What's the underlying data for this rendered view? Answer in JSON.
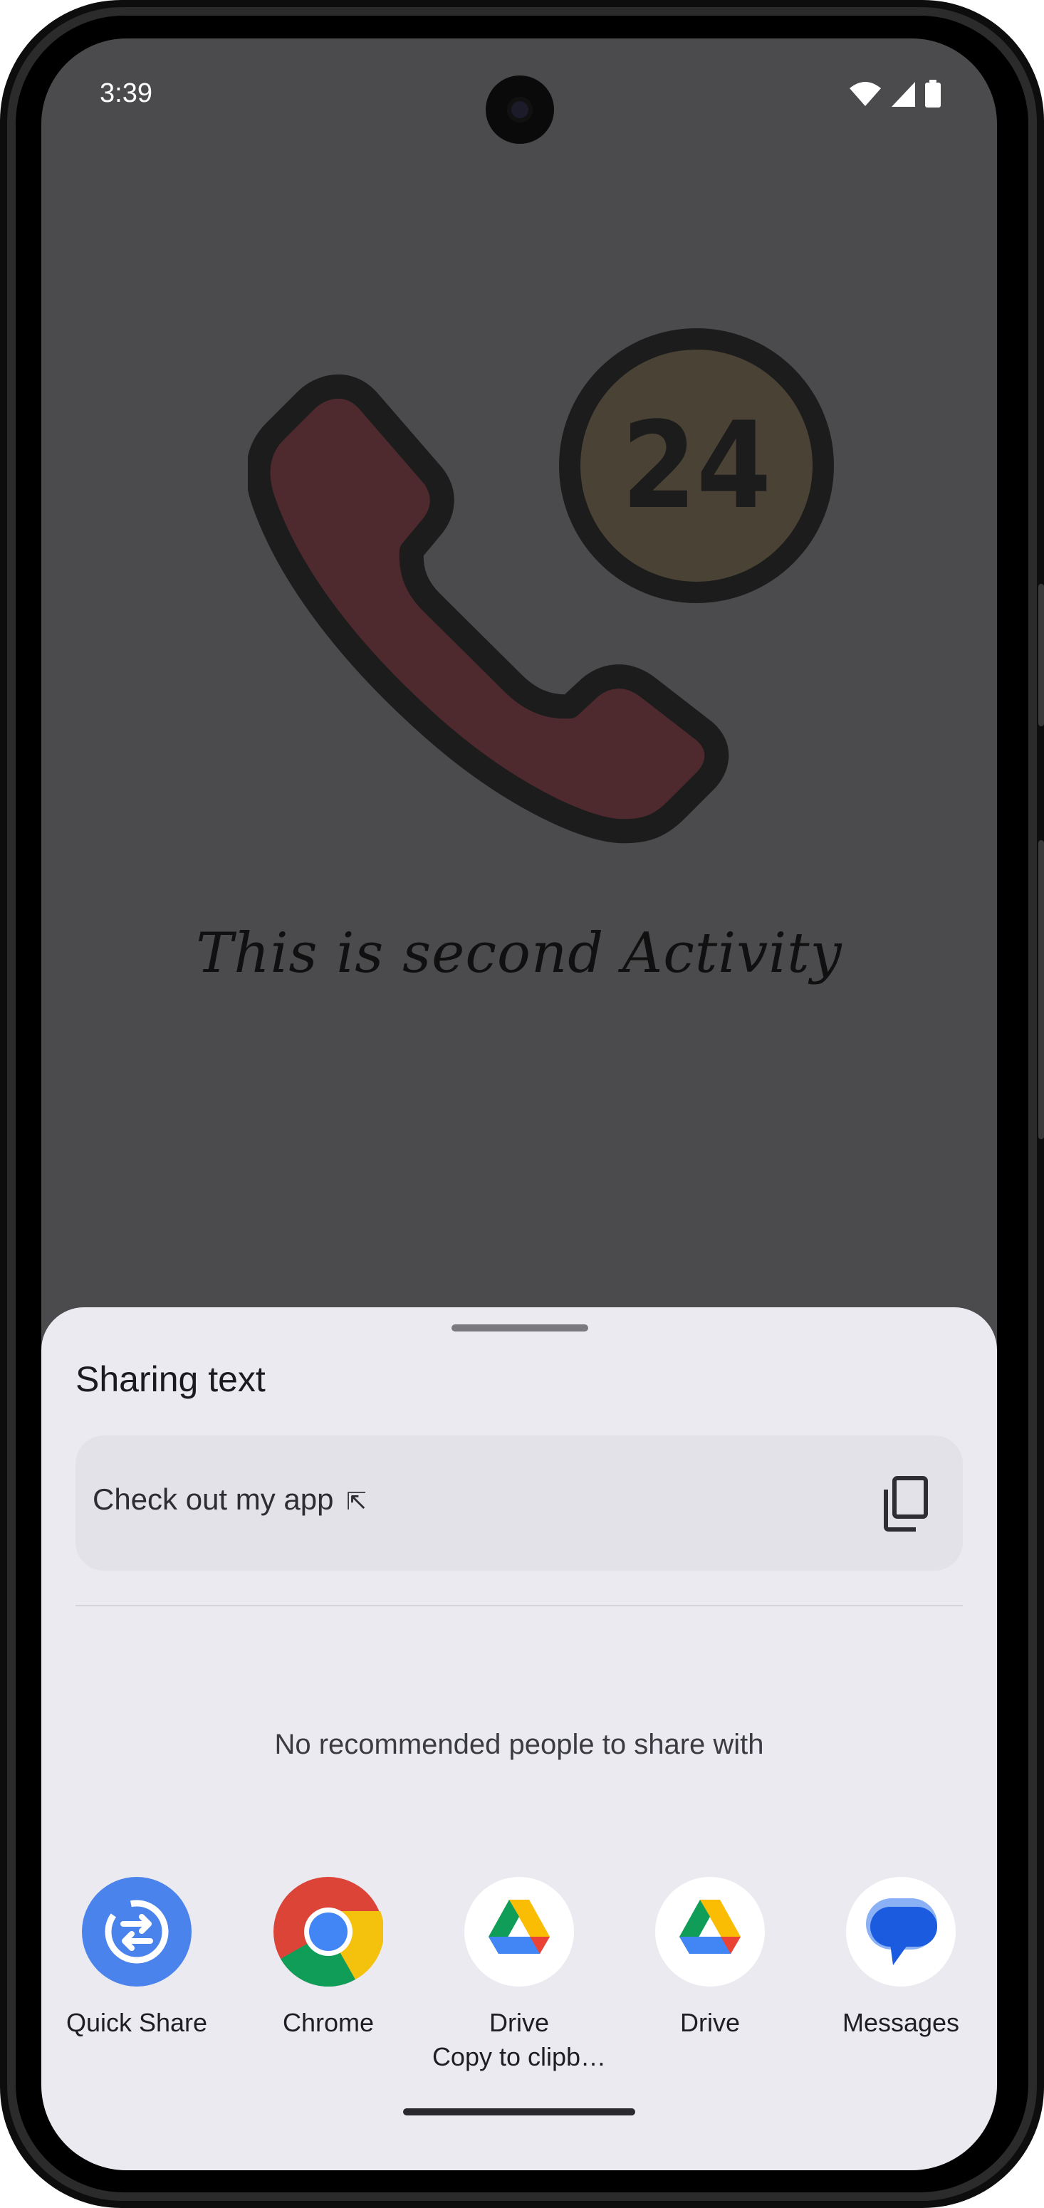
{
  "status_bar": {
    "time": "3:39",
    "icons": [
      "wifi-icon",
      "cell-signal-icon",
      "battery-icon"
    ]
  },
  "activity": {
    "badge_number": "24",
    "message": "This is second Activity",
    "colors": {
      "phone_fill": "#4e2a2f",
      "badge_fill": "#4a4234",
      "outline": "#1c1c1c",
      "background": "#4b4a4d"
    }
  },
  "share_sheet": {
    "title": "Sharing text",
    "preview_text": "Check out my app",
    "preview_arrow": "⇱",
    "copy_icon": "copy-icon",
    "empty_people": "No recommended people to share with",
    "apps": [
      {
        "label": "Quick Share",
        "sub": "",
        "icon": "quick-share-icon"
      },
      {
        "label": "Chrome",
        "sub": "",
        "icon": "chrome-icon"
      },
      {
        "label": "Drive",
        "sub": "Copy to clipb…",
        "icon": "drive-icon"
      },
      {
        "label": "Drive",
        "sub": "",
        "icon": "drive-icon"
      },
      {
        "label": "Messages",
        "sub": "",
        "icon": "messages-icon"
      }
    ],
    "colors": {
      "sheet_background": "#ebeaf0",
      "preview_background": "#e3e2e9",
      "quick_share_blue": "#4a83ec",
      "messages_blue": "#1a5be0"
    }
  }
}
